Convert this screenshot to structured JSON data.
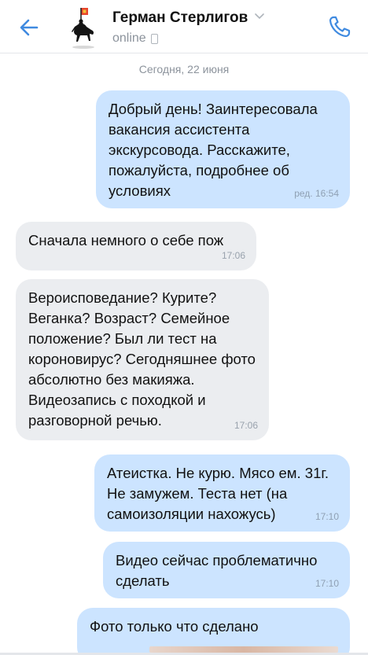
{
  "header": {
    "contact_name": "Герман Стерлигов",
    "status": "online"
  },
  "chat": {
    "date_separator": "Сегодня, 22 июня",
    "messages": [
      {
        "direction": "out",
        "text": "Добрый день! Заинтересовала вакансия ассистента экскурсовода. Расскажите, пожалуйста, подробнее об условиях",
        "time": "ред. 16:54"
      },
      {
        "direction": "in",
        "text": "Сначала немного о себе пож",
        "time": "17:06"
      },
      {
        "direction": "in",
        "text": "Вероисповедание? Курите? Веганка? Возраст? Семейное положение? Был ли тест на короновирус? Сегодняшнее фото абсолютно без макияжа. Видеозапись с походкой и разговорной речью.",
        "time": "17:06"
      },
      {
        "direction": "out",
        "text": "Атеистка. Не курю. Мясо ем. 31г. Не замужем. Теста нет (на самоизоляции нахожусь)",
        "time": "17:10"
      },
      {
        "direction": "out",
        "text": "Видео сейчас проблематично сделать",
        "time": "17:10"
      },
      {
        "direction": "out",
        "text": "Фото только что сделано",
        "time": ""
      }
    ]
  },
  "colors": {
    "accent": "#3f8ae0",
    "outgoing_bubble": "#cce4ff",
    "incoming_bubble": "#ebedf0"
  },
  "icons": {
    "back": "arrow-left-icon",
    "avatar": "horseman-flag-avatar",
    "chevron": "chevron-down-icon",
    "device": "mobile-device-icon",
    "call": "phone-icon"
  }
}
